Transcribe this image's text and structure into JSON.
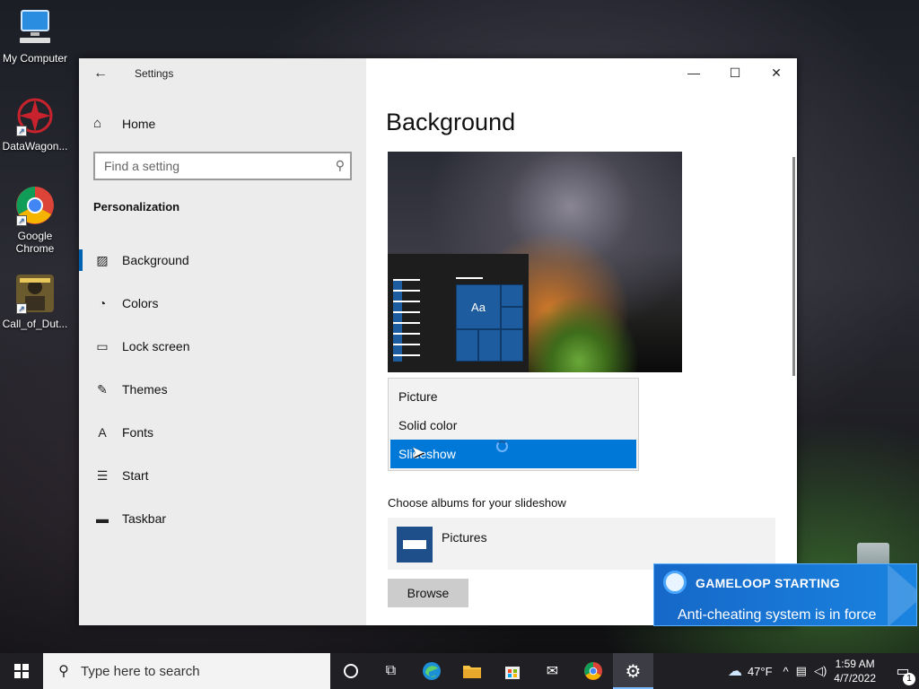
{
  "desktop": {
    "icons": [
      {
        "label": "My Computer"
      },
      {
        "label": "DataWagon..."
      },
      {
        "label": "Google Chrome"
      },
      {
        "label": "Call_of_Dut..."
      }
    ]
  },
  "window": {
    "title": "Settings",
    "controls": {
      "minimize": "—",
      "maximize": "☐",
      "close": "✕"
    }
  },
  "sidebar": {
    "home_label": "Home",
    "search_placeholder": "Find a setting",
    "section_title": "Personalization",
    "items": [
      {
        "label": "Background",
        "icon": "image-icon",
        "active": true
      },
      {
        "label": "Colors",
        "icon": "palette-icon"
      },
      {
        "label": "Lock screen",
        "icon": "lock-screen-icon"
      },
      {
        "label": "Themes",
        "icon": "brush-icon"
      },
      {
        "label": "Fonts",
        "icon": "font-icon"
      },
      {
        "label": "Start",
        "icon": "start-icon"
      },
      {
        "label": "Taskbar",
        "icon": "taskbar-icon"
      }
    ]
  },
  "main": {
    "title": "Background",
    "preview": {
      "tile_label": "Aa"
    },
    "background_options": [
      "Picture",
      "Solid color",
      "Slideshow"
    ],
    "selected_option": "Slideshow",
    "albums_label": "Choose albums for your slideshow",
    "album_name": "Pictures",
    "browse_label": "Browse"
  },
  "toast": {
    "title": "GAMELOOP STARTING",
    "message": "Anti-cheating system is in force"
  },
  "taskbar": {
    "search_placeholder": "Type here to search",
    "weather": "47°F",
    "time": "1:59 AM",
    "date": "4/7/2022",
    "notification_count": "1"
  },
  "colors": {
    "accent": "#0078d7",
    "sidebar_bg": "#ececec",
    "taskbar_bg": "#1f1f24",
    "toast_bg": "#1a83e0"
  }
}
